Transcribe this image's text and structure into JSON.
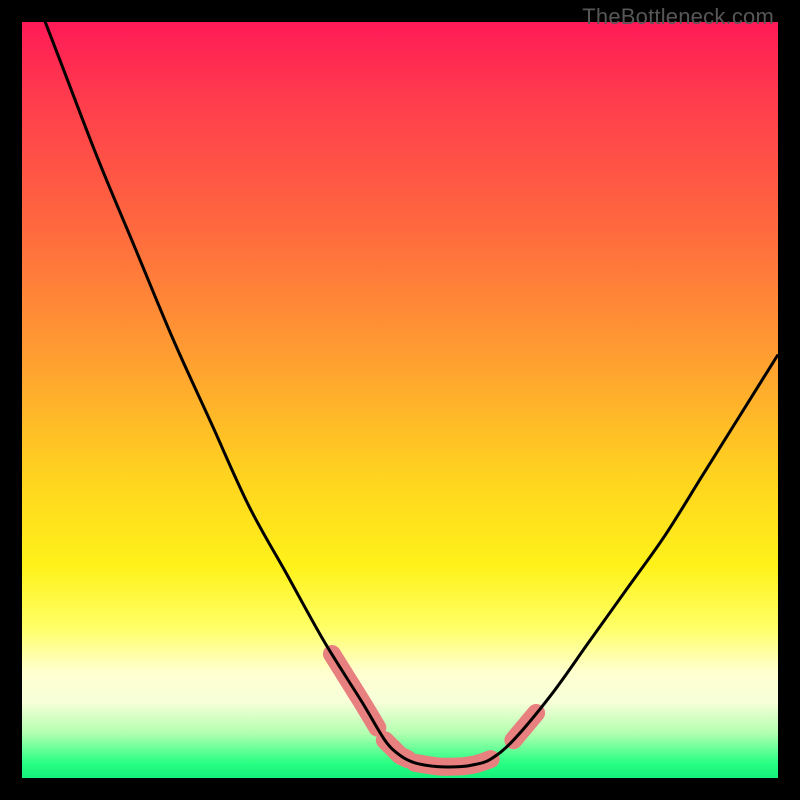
{
  "attribution": "TheBottleneck.com",
  "chart_data": {
    "type": "line",
    "title": "",
    "xlabel": "",
    "ylabel": "",
    "xlim": [
      0,
      100
    ],
    "ylim": [
      0,
      100
    ],
    "grid": false,
    "legend": false,
    "description": "Bottleneck curve over rainbow gradient background (red=high, green=low). Single V-shaped black curve with a flat minimum region highlighted by thick salmon stroke segments near the bottom.",
    "series": [
      {
        "name": "bottleneck-curve",
        "x": [
          0,
          5,
          10,
          15,
          20,
          25,
          30,
          35,
          40,
          45,
          48,
          50,
          52,
          55,
          58,
          60,
          62,
          65,
          70,
          75,
          80,
          85,
          90,
          95,
          100
        ],
        "values": [
          108,
          95,
          82,
          70,
          58,
          47,
          36,
          27,
          18,
          10,
          5,
          3,
          2,
          1.5,
          1.5,
          1.8,
          2.5,
          5,
          11,
          18,
          25,
          32,
          40,
          48,
          56
        ]
      }
    ],
    "highlight_segments": [
      {
        "x_start": 41,
        "x_end": 47
      },
      {
        "x_start": 48,
        "x_end": 51
      },
      {
        "x_start": 52,
        "x_end": 62
      },
      {
        "x_start": 65,
        "x_end": 68
      }
    ],
    "colors": {
      "curve": "#000000",
      "highlight": "#e88080",
      "gradient_top": "#ff1a57",
      "gradient_mid": "#ffd31f",
      "gradient_bottom": "#14f07a"
    }
  }
}
